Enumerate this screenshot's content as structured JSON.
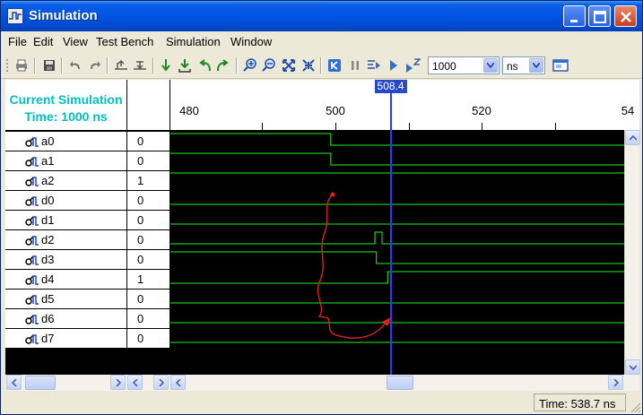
{
  "window": {
    "title": "Simulation"
  },
  "menu": [
    "File",
    "Edit",
    "View",
    "Test Bench",
    "Simulation",
    "Window"
  ],
  "toolbar": {
    "run_time": "1000",
    "time_unit": "ns"
  },
  "header": {
    "line1": "Current Simulation",
    "line2": "Time: 1000 ns"
  },
  "time_axis": {
    "ticks": [
      "480",
      "500",
      "520",
      "54"
    ],
    "visible_range": [
      477.5,
      541.8
    ]
  },
  "cursor": {
    "label": "508.4",
    "time": 508.4
  },
  "signals": [
    {
      "name": "a0",
      "value": "0"
    },
    {
      "name": "a1",
      "value": "0"
    },
    {
      "name": "a2",
      "value": "1"
    },
    {
      "name": "d0",
      "value": "0"
    },
    {
      "name": "d1",
      "value": "0"
    },
    {
      "name": "d2",
      "value": "0"
    },
    {
      "name": "d3",
      "value": "0"
    },
    {
      "name": "d4",
      "value": "1"
    },
    {
      "name": "d5",
      "value": "0"
    },
    {
      "name": "d6",
      "value": "0"
    },
    {
      "name": "d7",
      "value": "0"
    }
  ],
  "waveforms": {
    "a0": [
      [
        477.5,
        1
      ],
      [
        500,
        0
      ]
    ],
    "a1": [
      [
        477.5,
        1
      ],
      [
        500,
        0
      ]
    ],
    "a2": [
      [
        477.5,
        1
      ]
    ],
    "d0": [
      [
        477.5,
        0
      ]
    ],
    "d1": [
      [
        477.5,
        0
      ]
    ],
    "d2": [
      [
        477.5,
        0
      ],
      [
        506.2,
        1
      ],
      [
        507.2,
        0
      ]
    ],
    "d3": [
      [
        477.5,
        1
      ],
      [
        506.4,
        0
      ]
    ],
    "d4": [
      [
        477.5,
        0
      ],
      [
        508.0,
        1
      ]
    ],
    "d5": [
      [
        477.5,
        0
      ]
    ],
    "d6": [
      [
        477.5,
        0
      ]
    ],
    "d7": [
      [
        477.5,
        0
      ]
    ]
  },
  "colors": {
    "wave": "#19c219",
    "cursor": "#2a3cff",
    "annotation": "#e02020",
    "header_text": "#00c0c0"
  },
  "status": {
    "time": "Time: 538.7 ns"
  }
}
